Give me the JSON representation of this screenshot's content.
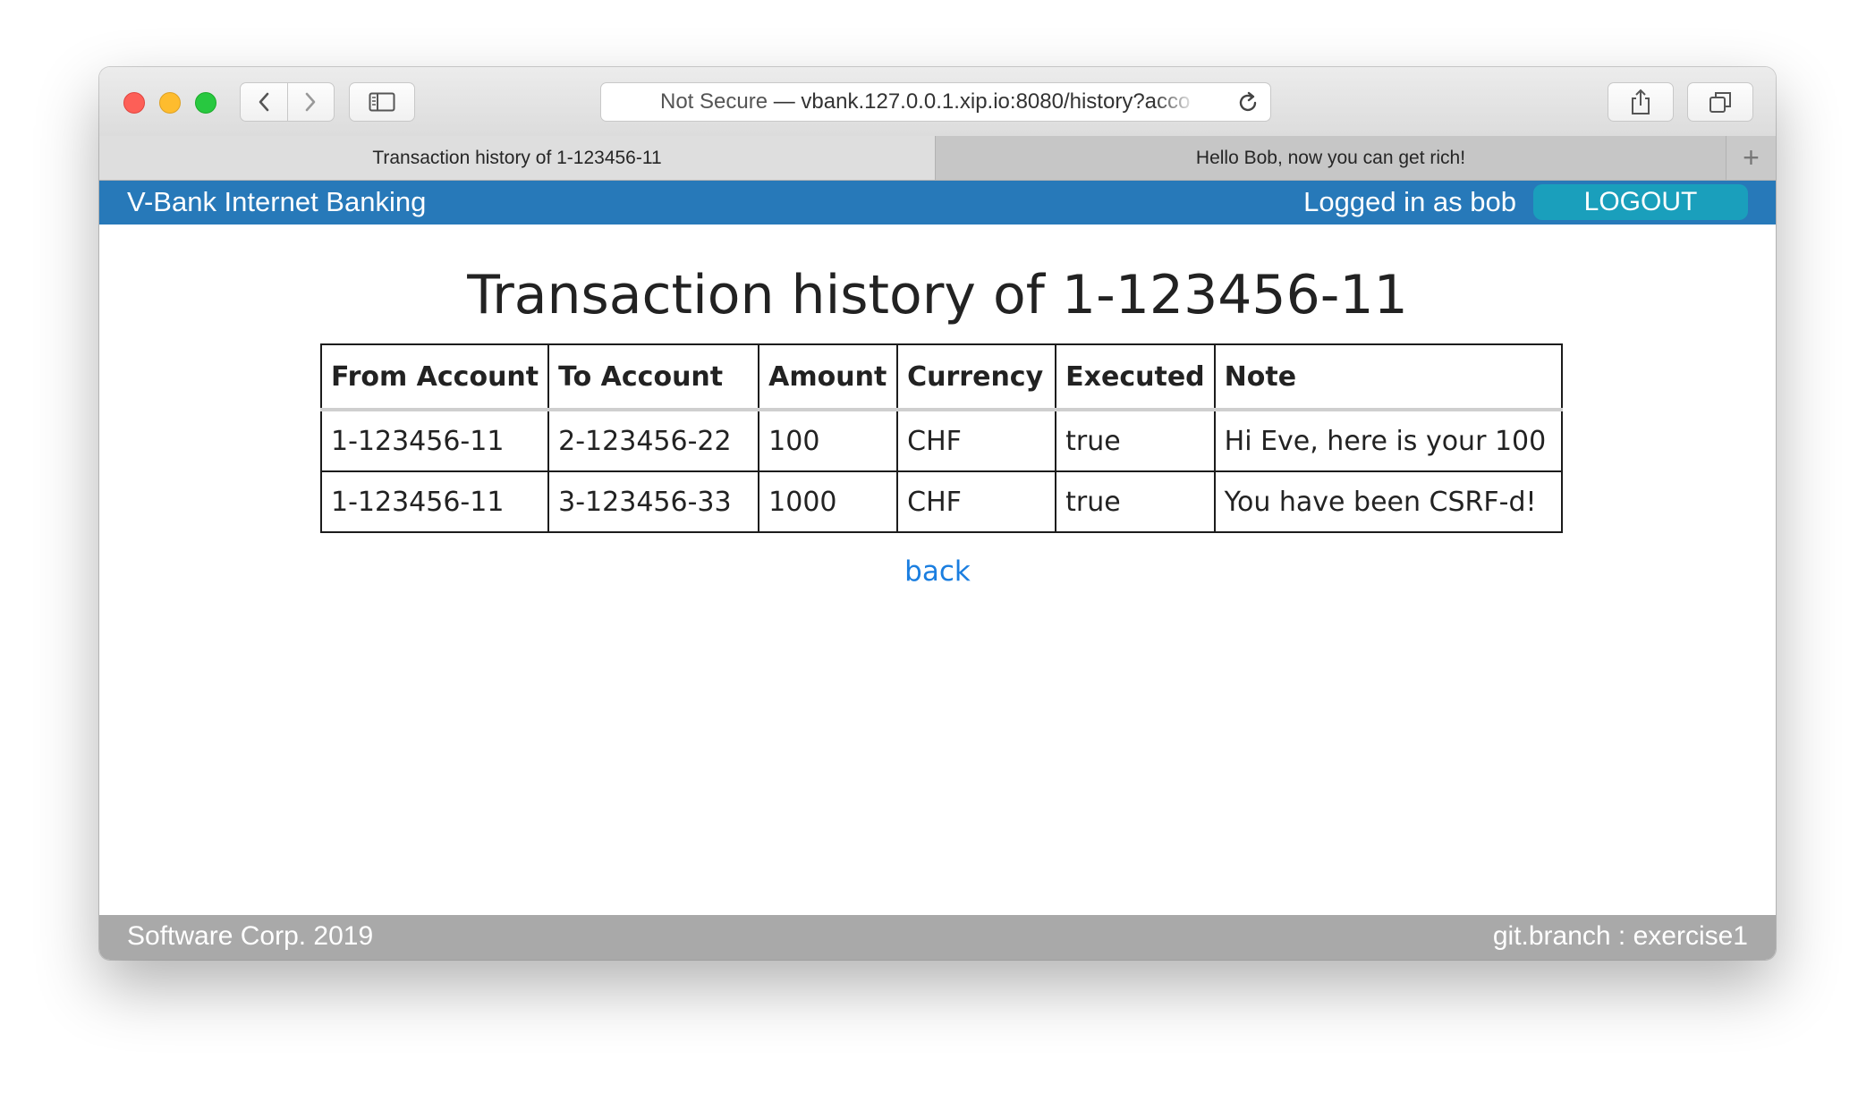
{
  "browser": {
    "address_bar": {
      "security_label": "Not Secure",
      "separator": "—",
      "url": "vbank.127.0.0.1.xip.io:8080/history?acco"
    },
    "tabs": [
      {
        "title": "Transaction history of 1-123456-11",
        "active": true
      },
      {
        "title": "Hello Bob, now you can get rich!",
        "active": false
      }
    ],
    "new_tab_label": "+"
  },
  "header": {
    "brand": "V-Bank Internet Banking",
    "login_status": "Logged in as bob",
    "logout_label": "LOGOUT",
    "colors": {
      "bar": "#2779b9",
      "logout_button": "#1a9fbc"
    }
  },
  "main": {
    "title": "Transaction history of 1-123456-11",
    "table": {
      "columns": [
        "From Account",
        "To Account",
        "Amount",
        "Currency",
        "Executed",
        "Note"
      ],
      "rows": [
        [
          "1-123456-11",
          "2-123456-22",
          "100",
          "CHF",
          "true",
          "Hi Eve, here is your 100"
        ],
        [
          "1-123456-11",
          "3-123456-33",
          "1000",
          "CHF",
          "true",
          "You have been CSRF-d!"
        ]
      ]
    },
    "back_link": "back"
  },
  "footer": {
    "left": "Software Corp. 2019",
    "right": "git.branch : exercise1"
  }
}
